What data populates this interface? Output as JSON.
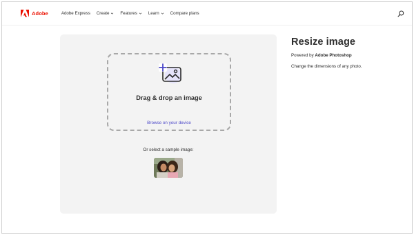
{
  "nav": {
    "brand": "Adobe",
    "items": [
      {
        "label": "Adobe Express",
        "has_dropdown": false
      },
      {
        "label": "Create",
        "has_dropdown": true
      },
      {
        "label": "Features",
        "has_dropdown": true
      },
      {
        "label": "Learn",
        "has_dropdown": true
      },
      {
        "label": "Compare plans",
        "has_dropdown": false
      }
    ],
    "search_icon": "search-icon"
  },
  "upload": {
    "icon": "add-image-icon",
    "title": "Drag & drop an image",
    "browse_label": "Browse on your device",
    "sample_label": "Or select a sample image:"
  },
  "info": {
    "title": "Resize image",
    "powered_prefix": "Powered by",
    "powered_brand": "Adobe Photoshop",
    "description": "Change the dimensions of any photo."
  },
  "colors": {
    "brand_red": "#eb1000",
    "link_blue": "#4b47c8",
    "panel_bg": "#f3f3f3"
  }
}
